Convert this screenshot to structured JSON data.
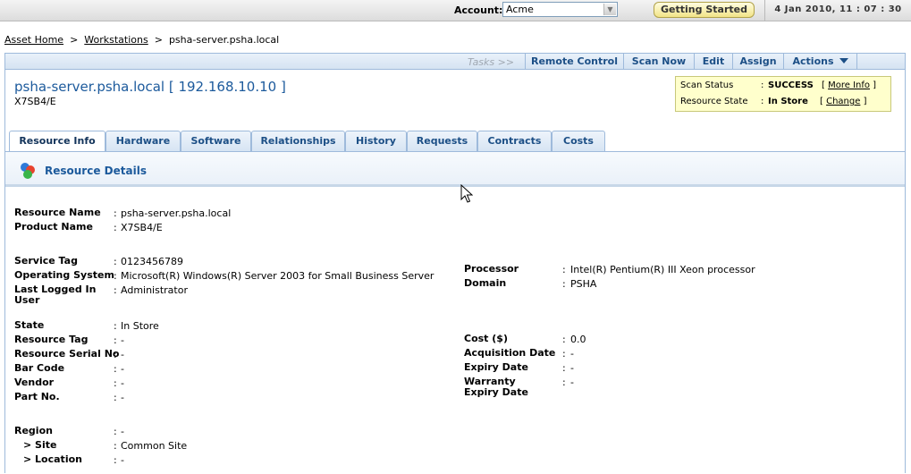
{
  "topbar": {
    "account_label": "Account:",
    "account_value": "Acme",
    "getting_started": "Getting Started",
    "datetime": "4 Jan 2010, 11 : 07 : 30"
  },
  "breadcrumb": [
    "Asset Home",
    "Workstations",
    "psha-server.psha.local"
  ],
  "actions": {
    "tasks_label": "Tasks >>",
    "buttons": [
      "Remote Control",
      "Scan Now",
      "Edit",
      "Assign",
      "Actions"
    ]
  },
  "resource": {
    "title": "psha-server.psha.local [ 192.168.10.10 ]",
    "subtitle": "X7SB4/E"
  },
  "status": {
    "scan_status_label": "Scan Status",
    "scan_status_value": "SUCCESS",
    "scan_link": "More Info",
    "state_label": "Resource State",
    "state_value": "In Store",
    "state_link": "Change"
  },
  "tabs": [
    "Resource Info",
    "Hardware",
    "Software",
    "Relationships",
    "History",
    "Requests",
    "Contracts",
    "Costs"
  ],
  "section_title": "Resource Details",
  "fields": {
    "resource_name": {
      "label": "Resource Name",
      "value": "psha-server.psha.local"
    },
    "product_name": {
      "label": "Product Name",
      "value": "X7SB4/E"
    },
    "service_tag": {
      "label": "Service Tag",
      "value": "0123456789"
    },
    "os": {
      "label": "Operating System",
      "value": "Microsoft(R) Windows(R) Server 2003 for Small Business Server"
    },
    "last_logged": {
      "label": "Last Logged In User",
      "value": "Administrator"
    },
    "processor": {
      "label": "Processor",
      "value": "Intel(R) Pentium(R) III Xeon processor"
    },
    "domain": {
      "label": "Domain",
      "value": "PSHA"
    },
    "state": {
      "label": "State",
      "value": "In Store"
    },
    "resource_tag": {
      "label": "Resource Tag",
      "value": "-"
    },
    "serial_no": {
      "label": "Resource Serial No",
      "value": "-"
    },
    "bar_code": {
      "label": "Bar Code",
      "value": "-"
    },
    "vendor": {
      "label": "Vendor",
      "value": "-"
    },
    "part_no": {
      "label": "Part No.",
      "value": "-"
    },
    "cost": {
      "label": "Cost ($)",
      "value": "0.0"
    },
    "acq_date": {
      "label": "Acquisition Date",
      "value": "-"
    },
    "expiry_date": {
      "label": "Expiry Date",
      "value": "-"
    },
    "warranty": {
      "label": "Warranty Expiry Date",
      "value": "-"
    },
    "region": {
      "label": "Region",
      "value": "-"
    },
    "site": {
      "label": "> Site",
      "value": "Common Site"
    },
    "location": {
      "label": "> Location",
      "value": "-"
    }
  }
}
